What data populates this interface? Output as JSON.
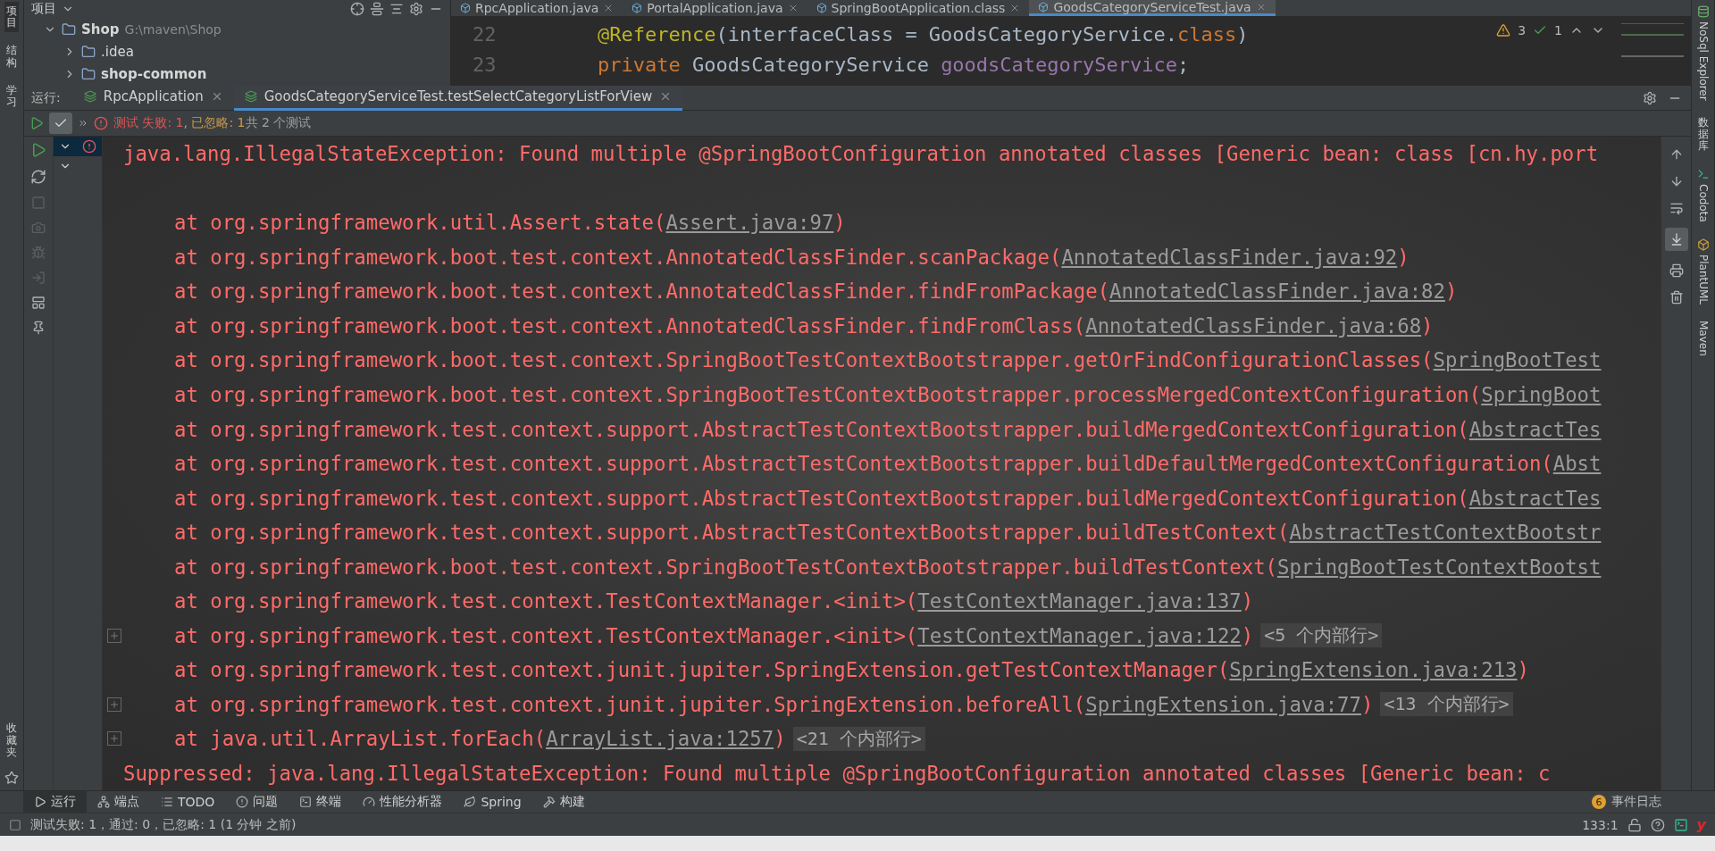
{
  "left_stripe": [
    {
      "label": "项目",
      "selected": true
    },
    {
      "label": "结构",
      "selected": false
    },
    {
      "label": "学习",
      "selected": false
    }
  ],
  "left_stripe_bottom": {
    "label": "收藏夹"
  },
  "project_panel": {
    "title": "项目",
    "tree": [
      {
        "name": "Shop",
        "path": "G:\\maven\\Shop",
        "expanded": true,
        "children": [
          {
            "name": ".idea",
            "bold": false,
            "expanded": false
          },
          {
            "name": "shop-common",
            "bold": true,
            "expanded": false
          }
        ]
      }
    ]
  },
  "editor": {
    "tabs": [
      {
        "label": "RpcApplication.java",
        "selected": false
      },
      {
        "label": "PortalApplication.java",
        "selected": false
      },
      {
        "label": "SpringBootApplication.class",
        "selected": false
      },
      {
        "label": "GoodsCategoryServiceTest.java",
        "selected": true
      }
    ],
    "lines": [
      {
        "number": "22",
        "tokens": [
          {
            "kind": "annotation",
            "text": "@Reference"
          },
          {
            "kind": "plain",
            "text": "(interfaceClass = GoodsCategoryService."
          },
          {
            "kind": "keyword",
            "text": "class"
          },
          {
            "kind": "plain",
            "text": ")"
          }
        ]
      },
      {
        "number": "23",
        "tokens": [
          {
            "kind": "keyword",
            "text": "private "
          },
          {
            "kind": "plain",
            "text": "GoodsCategoryService "
          },
          {
            "kind": "field",
            "text": "goodsCategoryService"
          },
          {
            "kind": "plain",
            "text": ";"
          }
        ]
      }
    ],
    "warnings": "3",
    "weak_warnings": "1"
  },
  "run_panel": {
    "label": "运行:",
    "tabs": [
      {
        "label": "RpcApplication",
        "selected": false
      },
      {
        "label": "GoodsCategoryServiceTest.testSelectCategoryListForView",
        "selected": true
      }
    ],
    "show_passed": {
      "checked": true
    },
    "summary": [
      {
        "kind": "failed",
        "text": "测试 失败: 1"
      },
      {
        "kind": "plain",
        "text": ", "
      },
      {
        "kind": "ignored",
        "text": "已忽略: 1"
      },
      {
        "kind": "plain",
        "text": "共 2 个测试"
      }
    ],
    "tree": [
      {
        "selected": true,
        "failed": true
      },
      {
        "selected": false,
        "failed": false
      }
    ],
    "console": [
      {
        "kind": "error",
        "text": "java.lang.IllegalStateException: Found multiple @SpringBootConfiguration annotated classes [Generic bean: class [cn.hy.port"
      },
      {
        "kind": "blank"
      },
      {
        "kind": "frame",
        "text": "at org.springframework.util.Assert.state(",
        "link": "Assert.java:97",
        "suffix": ")",
        "expandable": false
      },
      {
        "kind": "frame",
        "text": "at org.springframework.boot.test.context.AnnotatedClassFinder.scanPackage(",
        "link": "AnnotatedClassFinder.java:92",
        "suffix": ")",
        "expandable": false
      },
      {
        "kind": "frame",
        "text": "at org.springframework.boot.test.context.AnnotatedClassFinder.findFromPackage(",
        "link": "AnnotatedClassFinder.java:82",
        "suffix": ")",
        "expandable": false
      },
      {
        "kind": "frame",
        "text": "at org.springframework.boot.test.context.AnnotatedClassFinder.findFromClass(",
        "link": "AnnotatedClassFinder.java:68",
        "suffix": ")",
        "expandable": false
      },
      {
        "kind": "frame",
        "text": "at org.springframework.boot.test.context.SpringBootTestContextBootstrapper.getOrFindConfigurationClasses(",
        "link": "SpringBootTest",
        "expandable": false
      },
      {
        "kind": "frame",
        "text": "at org.springframework.boot.test.context.SpringBootTestContextBootstrapper.processMergedContextConfiguration(",
        "link": "SpringBoot",
        "expandable": false
      },
      {
        "kind": "frame",
        "text": "at org.springframework.test.context.support.AbstractTestContextBootstrapper.buildMergedContextConfiguration(",
        "link": "AbstractTes",
        "expandable": false
      },
      {
        "kind": "frame",
        "text": "at org.springframework.test.context.support.AbstractTestContextBootstrapper.buildDefaultMergedContextConfiguration(",
        "link": "Abst",
        "expandable": false
      },
      {
        "kind": "frame",
        "text": "at org.springframework.test.context.support.AbstractTestContextBootstrapper.buildMergedContextConfiguration(",
        "link": "AbstractTes",
        "expandable": false
      },
      {
        "kind": "frame",
        "text": "at org.springframework.test.context.support.AbstractTestContextBootstrapper.buildTestContext(",
        "link": "AbstractTestContextBootstr",
        "expandable": false
      },
      {
        "kind": "frame",
        "text": "at org.springframework.boot.test.context.SpringBootTestContextBootstrapper.buildTestContext(",
        "link": "SpringBootTestContextBootst",
        "expandable": false
      },
      {
        "kind": "frame",
        "text": "at org.springframework.test.context.TestContextManager.<init>(",
        "link": "TestContextManager.java:137",
        "suffix": ")",
        "expandable": false
      },
      {
        "kind": "frame",
        "text": "at org.springframework.test.context.TestContextManager.<init>(",
        "link": "TestContextManager.java:122",
        "suffix": ")",
        "folded": "<5 个内部行>",
        "expandable": true
      },
      {
        "kind": "frame",
        "text": "at org.springframework.test.context.junit.jupiter.SpringExtension.getTestContextManager(",
        "link": "SpringExtension.java:213",
        "suffix": ")",
        "expandable": false
      },
      {
        "kind": "frame",
        "text": "at org.springframework.test.context.junit.jupiter.SpringExtension.beforeAll(",
        "link": "SpringExtension.java:77",
        "suffix": ")",
        "folded": "<13 个内部行>",
        "expandable": true
      },
      {
        "kind": "frame",
        "text": "at java.util.ArrayList.forEach(",
        "link": "ArrayList.java:1257",
        "suffix": ")",
        "folded": "<21 个内部行>",
        "expandable": true
      },
      {
        "kind": "error",
        "text": "Suppressed: java.lang.IllegalStateException: Found multiple @SpringBootConfiguration annotated classes [Generic bean: c"
      }
    ]
  },
  "right_stripe": [
    {
      "label": "NoSql Explorer",
      "kind": "latin"
    },
    {
      "label": "数据库",
      "kind": "cjk"
    },
    {
      "label": "Codota",
      "kind": "latin"
    },
    {
      "label": "PlantUML",
      "kind": "latin"
    },
    {
      "label": "Maven",
      "kind": "latin"
    }
  ],
  "tool_tabs": [
    {
      "label": "运行",
      "selected": true
    },
    {
      "label": "端点",
      "selected": false
    },
    {
      "label": "TODO",
      "selected": false
    },
    {
      "label": "问题",
      "selected": false
    },
    {
      "label": "终端",
      "selected": false
    },
    {
      "label": "性能分析器",
      "selected": false
    },
    {
      "label": "Spring",
      "selected": false
    },
    {
      "label": "构建",
      "selected": false
    }
  ],
  "event_log": {
    "count": "6",
    "label": "事件日志"
  },
  "status_bar": {
    "message": "测试失败: 1，通过: 0，已忽略: 1 (1 分钟 之前)",
    "position": "133:1",
    "plugin_label": "y"
  }
}
